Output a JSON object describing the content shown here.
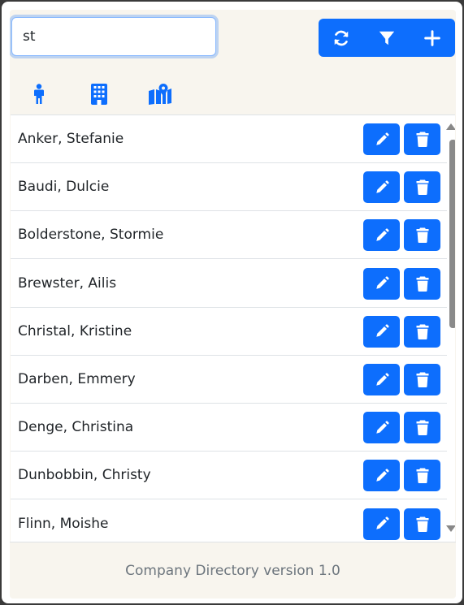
{
  "search": {
    "value": "st"
  },
  "toolbar": {
    "refresh_icon": "refresh-icon",
    "filter_icon": "filter-icon",
    "add_icon": "plus-icon"
  },
  "tabs": [
    {
      "icon": "person-icon"
    },
    {
      "icon": "building-icon"
    },
    {
      "icon": "map-location-icon"
    }
  ],
  "personnel": [
    {
      "name": "Anker, Stefanie"
    },
    {
      "name": "Baudi, Dulcie"
    },
    {
      "name": "Bolderstone, Stormie"
    },
    {
      "name": "Brewster, Ailis"
    },
    {
      "name": "Christal, Kristine"
    },
    {
      "name": "Darben, Emmery"
    },
    {
      "name": "Denge, Christina"
    },
    {
      "name": "Dunbobbin, Christy"
    },
    {
      "name": "Flinn, Moishe"
    }
  ],
  "row_actions": {
    "edit_icon": "pencil-icon",
    "delete_icon": "trash-icon"
  },
  "footer": {
    "text": "Company Directory version 1.0"
  },
  "colors": {
    "primary": "#0d6efd",
    "panel_bg": "#f8f5ee",
    "text": "#212529",
    "muted": "#6c757d"
  }
}
